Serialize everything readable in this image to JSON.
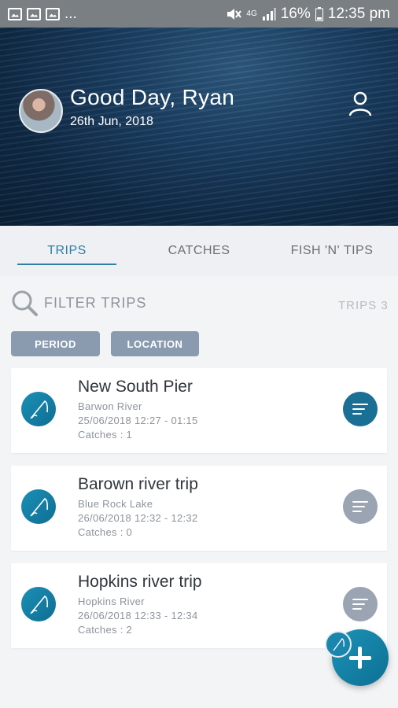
{
  "status_bar": {
    "left_icons": [
      "image-icon",
      "image-icon",
      "image-icon"
    ],
    "overflow_label": "...",
    "network_label": "4G",
    "battery_label": "16%",
    "time": "12:35 pm"
  },
  "header": {
    "greeting": "Good Day, Ryan",
    "date": "26th Jun, 2018",
    "profile_icon": "user-icon"
  },
  "tabs": [
    {
      "label": "TRIPS",
      "active": true
    },
    {
      "label": "CATCHES",
      "active": false
    },
    {
      "label": "FISH 'N' TIPS",
      "active": false
    }
  ],
  "filter": {
    "label": "FILTER TRIPS",
    "trips_count_label": "TRIPS  3",
    "chips": [
      "PERIOD",
      "LOCATION"
    ]
  },
  "trips": [
    {
      "title": "New South Pier",
      "location": "Barwon River",
      "datetime": "25/06/2018  12:27 - 01:15",
      "catches": "Catches : 1",
      "menu_color": "#1a6f95"
    },
    {
      "title": "Barown river trip",
      "location": "Blue Rock Lake",
      "datetime": "26/06/2018  12:32 - 12:32",
      "catches": "Catches : 0",
      "menu_color": "#9aa4b2"
    },
    {
      "title": "Hopkins river trip",
      "location": "Hopkins River",
      "datetime": "26/06/2018  12:33 - 12:34",
      "catches": "Catches : 2",
      "menu_color": "#9aa4b2"
    }
  ],
  "colors": {
    "accent": "#2f7fa7",
    "chip": "#8a9bb0",
    "fab": "#168bb3"
  }
}
